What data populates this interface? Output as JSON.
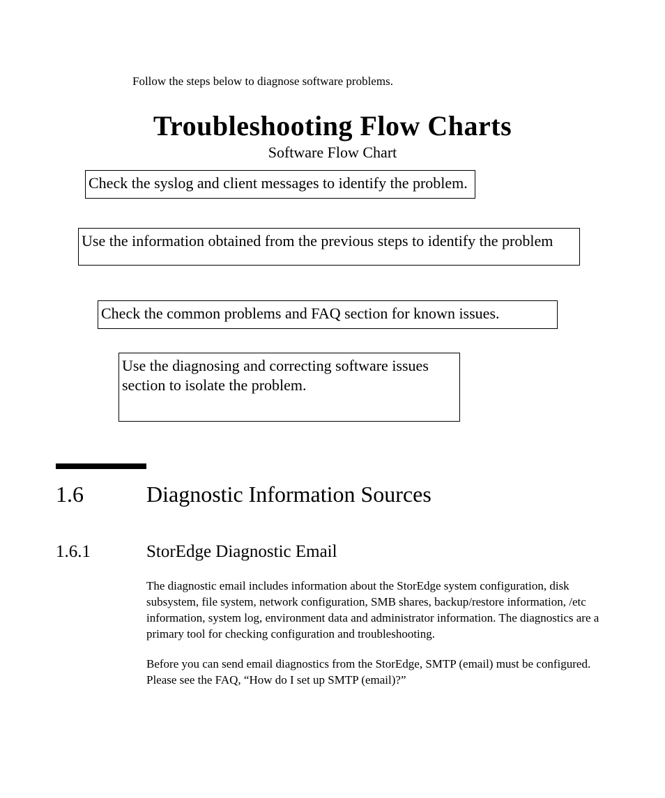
{
  "intro_text": "Follow the steps below to diagnose software problems.",
  "flow": {
    "title": "Troubleshooting Flow Charts",
    "subtitle": "Software Flow Chart",
    "boxes": [
      "Check the syslog and client messages to identify the problem.",
      "Use the information obtained from the previous steps to identify the problem",
      "Check the common problems and FAQ section for known issues.",
      "Use the diagnosing and correcting software issues section to isolate the problem."
    ]
  },
  "section": {
    "number": "1.6",
    "title": "Diagnostic Information Sources"
  },
  "subsection": {
    "number": "1.6.1",
    "title": "StorEdge Diagnostic Email",
    "paragraphs": [
      "The diagnostic email includes information about the StorEdge system configuration, disk subsystem, file system, network configuration, SMB shares, backup/restore information, /etc information, system log, environment data and administrator information. The diagnostics are a primary tool for checking configuration and troubleshooting.",
      "Before you can send email diagnostics from the StorEdge, SMTP (email) must be configured. Please see the FAQ, “How do I set up SMTP (email)?”"
    ]
  }
}
